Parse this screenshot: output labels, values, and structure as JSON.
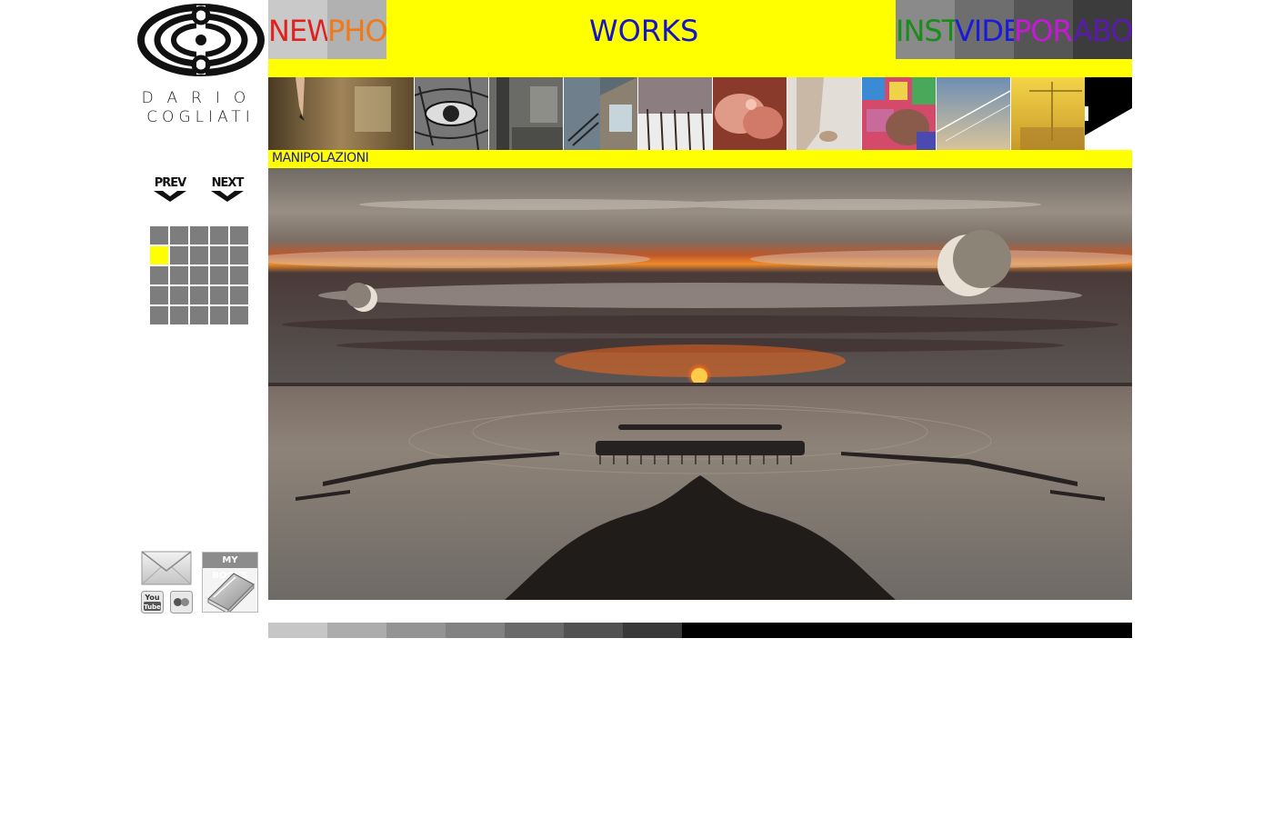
{
  "brand": {
    "first_name": "DARIO",
    "last_name": "COGLIATI"
  },
  "menu": {
    "title": "WORKS",
    "bar_color": "#ffff00",
    "tabs": [
      {
        "id": "new",
        "label": "NEW",
        "color": "#e0221f",
        "bg": "#c9c9c9"
      },
      {
        "id": "photo",
        "label": "PHO",
        "color": "#f07a18",
        "bg": "#b1b1b1"
      },
      {
        "id": "installations",
        "label": "INST.",
        "color": "#1a8c1a",
        "bg": "#8a8a8a"
      },
      {
        "id": "video",
        "label": "VIDE",
        "color": "#1a1ad8",
        "bg": "#6e6e6e"
      },
      {
        "id": "portfolio",
        "label": "POR",
        "color": "#c41ad8",
        "bg": "#555555"
      },
      {
        "id": "about",
        "label": "ABO",
        "color": "#5a1ab0",
        "bg": "#3c3c3c"
      }
    ]
  },
  "navigation": {
    "prev_label": "PREV",
    "next_label": "NEXT"
  },
  "grid": {
    "cells": 25,
    "active_index": 5,
    "cell_color": "#7d7d7d",
    "active_color": "#ffff00"
  },
  "section": {
    "label": "MANIPOLAZIONI"
  },
  "thumbnails": [
    {
      "name": "thumb-legs-hallway"
    },
    {
      "name": "thumb-eye-closeup"
    },
    {
      "name": "thumb-building-interior"
    },
    {
      "name": "thumb-staircase"
    },
    {
      "name": "thumb-snow-fence"
    },
    {
      "name": "thumb-hands-pink"
    },
    {
      "name": "thumb-body-white"
    },
    {
      "name": "thumb-colorful-collage"
    },
    {
      "name": "thumb-sky-contrail"
    },
    {
      "name": "thumb-crane-yellow"
    }
  ],
  "social": {
    "books_label": "MY BOOKS",
    "youtube_label": "You Tube"
  },
  "bottom_bar": {
    "segments": [
      "#c6c6c6",
      "#acacac",
      "#949494",
      "#828282",
      "#6a6a6a",
      "#525252",
      "#393939",
      "#000000"
    ]
  }
}
